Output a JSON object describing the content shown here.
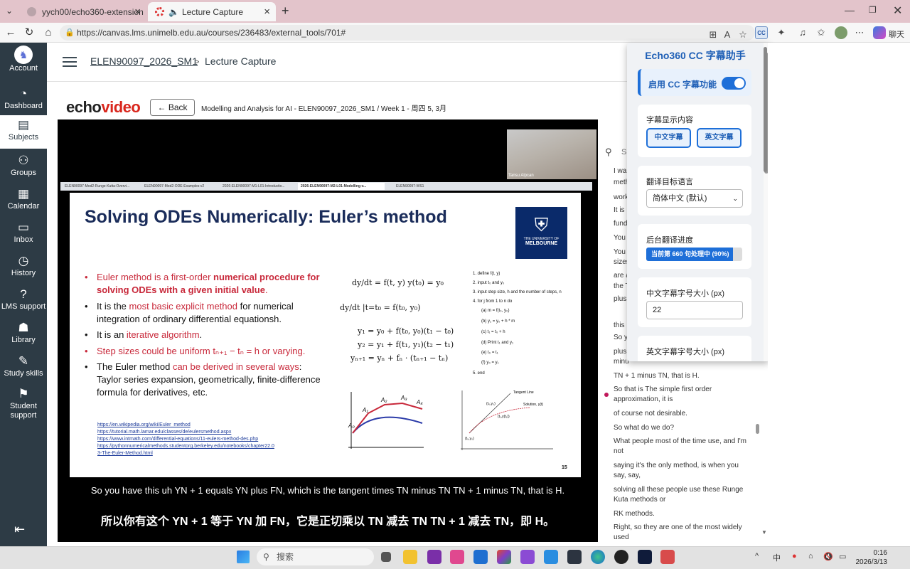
{
  "browser": {
    "tabs": [
      {
        "title": "yych00/echo360-extension"
      },
      {
        "title": "Lecture Capture"
      }
    ],
    "url": "https://canvas.lms.unimelb.edu.au/courses/236483/external_tools/701#",
    "chat_label": "聊天"
  },
  "nav": {
    "items": [
      {
        "label": "Account"
      },
      {
        "label": "Dashboard"
      },
      {
        "label": "Subjects"
      },
      {
        "label": "Groups"
      },
      {
        "label": "Calendar"
      },
      {
        "label": "Inbox"
      },
      {
        "label": "History"
      },
      {
        "label": "LMS support"
      },
      {
        "label": "Library"
      },
      {
        "label": "Study skills"
      },
      {
        "label": "Student support"
      }
    ]
  },
  "breadcrumb": {
    "course": "ELEN90097_2026_SM1",
    "separator": ">",
    "page": "Lecture Capture"
  },
  "player": {
    "logo_a": "echo",
    "logo_b": "video",
    "back_label": "Back",
    "title": "Modelling and Analysis for AI - ELEN90097_2026_SM1 / Week 1 - 周四 5, 3月",
    "presenter": "Tansu Alpcan",
    "slide_tabs": [
      "ELEN90097-Mod2-Runge-Kutta-Overvi...",
      "ELEN90097-Mod2-ODE-Examples-v2",
      "2026-ELEN90097-M1-L01-Introductio...",
      "2026-ELEN90097-M2-L01-Modelling-v...",
      "ELEN90097-WS1"
    ],
    "slide": {
      "title": "Solving ODEs Numerically: Euler’s method",
      "uni_name_small": "THE UNIVERSITY OF",
      "uni_name": "MELBOURNE",
      "bullets": [
        {
          "pre": "",
          "red": "Euler method",
          "mid": " is a first-order ",
          "bold": "numerical procedure for solving ODEs with a given initial value",
          "post": "."
        },
        {
          "pre": "It is the ",
          "red": "most basic explicit method",
          "mid": " for numerical integration of ordinary differential equationsh.",
          "bold": "",
          "post": ""
        },
        {
          "pre": "It is an ",
          "red": "iterative algorithm",
          "mid": ".",
          "bold": "",
          "post": ""
        },
        {
          "pre": "",
          "red": "Step sizes",
          "mid": " could be uniform  tₙ₊₁ − tₙ = h  or varying.",
          "bold": "",
          "post": ""
        },
        {
          "pre": "The Euler method ",
          "red": "can be derived in several ways",
          "mid": ": Taylor series expansion, geometrically, finite-difference formula for derivatives, etc.",
          "bold": "",
          "post": ""
        }
      ],
      "equations": [
        "dy/dt = f(t, y)      y(t₀) = y₀",
        "dy/dt |t=t₀ = f(t₀, y₀)",
        "y₁ = y₀ + f(t₀, y₀)(t₁ − t₀)",
        "y₂ = y₁ + f(t₁, y₁)(t₂ − t₁)",
        "yₙ₊₁ = yₙ + fₙ · (tₙ₊₁ − tₙ)"
      ],
      "algorithm": [
        "1. define f(t, y)",
        "2. input t₀ and y₀",
        "3. input step size, h and the number of steps, n",
        "4. for j from 1 to n do",
        "(a) m = f(t₀, y₀)",
        "(b) y₁ = y₀ + h * m",
        "(c) t₁ = t₀ + h",
        "(d) Print t₁ and y₁",
        "(e) t₀ = t₁",
        "(f) y₀ = y₁",
        "5. end"
      ],
      "fig1_labels": [
        "A₀",
        "A₁",
        "A₂",
        "A₃",
        "A₄"
      ],
      "fig2_labels": [
        "Tangent Line",
        "(t₀,y₀)",
        "(t₁,y(t₁))",
        "Solution, y(t)",
        "(t₀,y₀)"
      ],
      "links": [
        "https://en.wikipedia.org/wiki/Euler_method",
        "https://tutorial.math.lamar.edu/classes/de/eulersmethod.aspx",
        "https://www.intmath.com/differential-equations/11-eulers-method-des.php",
        "https://pythonnumericalmethods.studentorg.berkeley.edu/notebooks/chapter22.0",
        "3-The-Euler-Method.html"
      ],
      "page_number": "15"
    },
    "subtitle_en": "So you have this uh YN + 1 equals YN plus FN, which is the tangent times TN minus TN TN + 1 minus TN, that is H.",
    "subtitle_zh": "所以你有这个 YN + 1 等于 YN 加 FN，它是正切乘以 TN 减去 TN TN + 1 减去 TN，即 H。"
  },
  "transcript": {
    "search_placeholder": "S",
    "lines": [
      "I wa",
      "meth",
      "work",
      "It is",
      "fund",
      "You",
      "You",
      "sizes",
      "are a",
      "the T",
      "plus",
      "this",
      "So y",
      "plus",
      "minu",
      "TN + 1 minus TN, that is H.",
      "So that is The simple first order approximation, it is",
      "of course not desirable.",
      "So what do we do?",
      "What people most of the time use, and I'm not",
      "saying it's the only method, is when you say, say,",
      "solving all these people use these Runge Kuta methods or",
      "RK methods.",
      "Right, so they are one of the most widely used"
    ]
  },
  "extension": {
    "title": "Echo360 CC 字幕助手",
    "enable_label": "启用 CC 字幕功能",
    "enabled": true,
    "display_label": "字幕显示内容",
    "btn_zh": "中文字幕",
    "btn_en": "英文字幕",
    "target_lang_label": "翻译目标语言",
    "target_lang_value": "简体中文 (默认)",
    "progress_label": "后台翻译进度",
    "progress_text": "当前第 660 句处理中 (90%)",
    "progress_fraction": 0.9,
    "zh_size_label": "中文字幕字号大小 (px)",
    "zh_size_value": "22",
    "en_size_label": "英文字幕字号大小 (px)"
  },
  "taskbar": {
    "search_placeholder": "搜索",
    "ime": "中",
    "time": "0:16",
    "date": "2026/3/13"
  }
}
